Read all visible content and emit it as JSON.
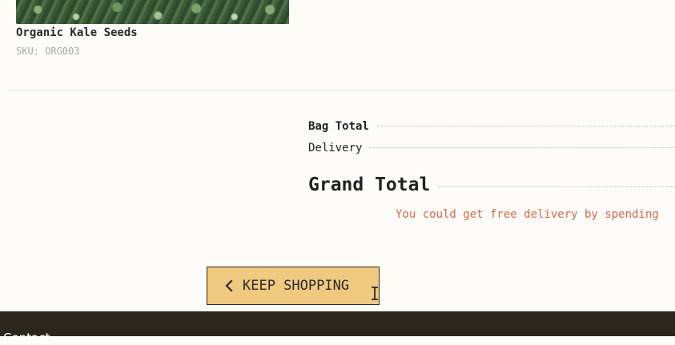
{
  "product": {
    "name": "Organic Kale Seeds",
    "sku": "SKU: ORG003",
    "image_icon": "kale-leaves-photo"
  },
  "summary": {
    "bag_total_label": "Bag Total",
    "delivery_label": "Delivery",
    "grand_total_label": "Grand Total",
    "free_delivery_note": "You could get free delivery by spending"
  },
  "actions": {
    "keep_shopping_label": "KEEP SHOPPING",
    "keep_shopping_icon": "chevron-left-icon"
  },
  "footer": {
    "text": "Contact"
  },
  "colors": {
    "page_background": "#fdfcf8",
    "button_background": "#efc97f",
    "note_color": "#d8694a",
    "footer_background": "#2b271d"
  }
}
